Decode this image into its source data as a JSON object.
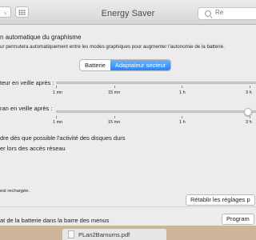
{
  "window": {
    "title": "Energy Saver",
    "search_placeholder": "Re"
  },
  "graphics": {
    "label": "n automatique du graphisme",
    "note": "ur permutera automatiquement entre les modes graphiques pour augmenter l'autonomie de la batterie."
  },
  "tabs": [
    {
      "label": "Batterie",
      "selected": false
    },
    {
      "label": "Adaptateur secteur",
      "selected": true
    }
  ],
  "sliders": {
    "computer_sleep": {
      "label": "teur en veille après :",
      "ticks": []
    },
    "display_sleep": {
      "label": "ran en veille après :",
      "value": "3 h",
      "ticks": [
        "1 mn",
        "15 mn",
        "1 h",
        "3 h"
      ]
    },
    "computer_sleep_ticks": [
      "1 mn",
      "15 mn",
      "1 h",
      "3 h"
    ]
  },
  "options": [
    "dre dès que possible l'activité des disques durs",
    "er lors des accès réseau"
  ],
  "charged_note": "est rechargée.",
  "buttons": {
    "restore_defaults": "Rétablir les réglages p",
    "schedule": "Program"
  },
  "battery_status": {
    "label": "at de la batterie dans la barre des menus"
  },
  "desktop": {
    "file_name": "PLan2Barnums.pdf"
  },
  "colors": {
    "accent": "#2e83f4",
    "pane": "#ececec",
    "desktop": "#cdb59a"
  }
}
